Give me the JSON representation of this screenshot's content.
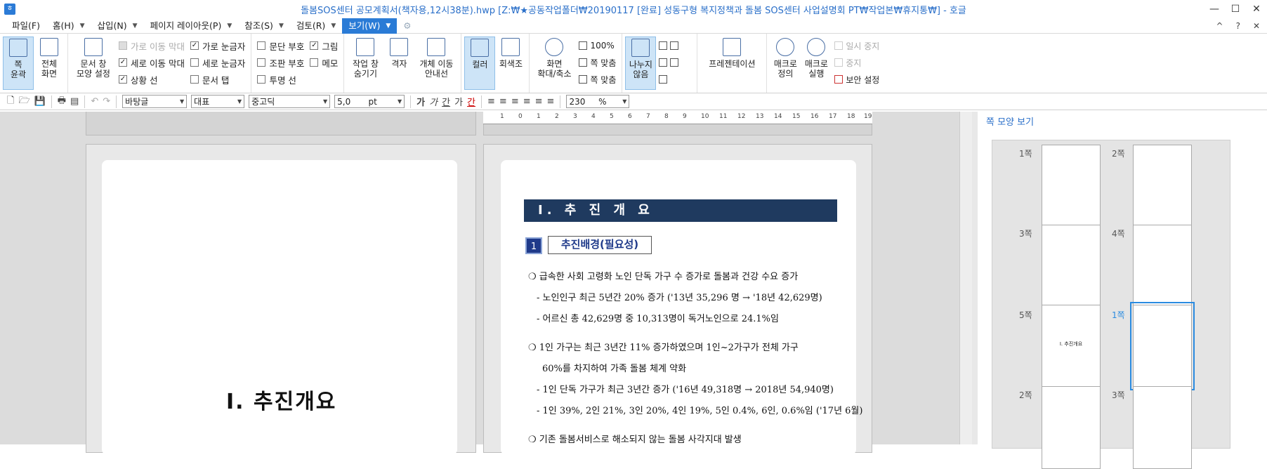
{
  "window": {
    "title": "돌봄SOS센터 공모계획서(책자용,12시38분).hwp [Z:₩★공동작업폴더₩20190117 [완료] 성동구형 복지정책과 돌봄 SOS센터 사업설명회 PT₩작업본₩휴지통₩] - 호글",
    "minimize": "—",
    "maximize": "☐",
    "close": "✕"
  },
  "menu": {
    "items": [
      {
        "label": "파일(F)"
      },
      {
        "label": "홈(H)"
      },
      {
        "label": "삽입(N)"
      },
      {
        "label": "페이지 레이아웃(P)"
      },
      {
        "label": "참조(S)"
      },
      {
        "label": "검토(R)"
      },
      {
        "label": "보기(W)"
      }
    ],
    "right": [
      "^",
      "?",
      "✕"
    ]
  },
  "ribbon": {
    "pagezoom": {
      "l1": "쪽",
      "l2": "윤곽"
    },
    "fullscreen": {
      "l1": "전체",
      "l2": "화면"
    },
    "docwin": {
      "l1": "문서 창",
      "l2": "모양 설정"
    },
    "checks": [
      {
        "label": "가로 이동 막대",
        "checked": false,
        "disabled": true
      },
      {
        "label": "세로 이동 막대",
        "checked": true,
        "disabled": false
      },
      {
        "label": "상황 선",
        "checked": true,
        "disabled": false
      },
      {
        "label": "가로 눈금자",
        "checked": true,
        "disabled": false
      },
      {
        "label": "세로 눈금자",
        "checked": false,
        "disabled": false
      },
      {
        "label": "문서 탭",
        "checked": false,
        "disabled": false
      },
      {
        "label": "문단 부호",
        "checked": false,
        "disabled": false
      },
      {
        "label": "조판 부호",
        "checked": false,
        "disabled": false
      },
      {
        "label": "투명 선",
        "checked": false,
        "disabled": false
      },
      {
        "label": "그림",
        "checked": true,
        "disabled": false
      },
      {
        "label": "메모",
        "checked": false,
        "disabled": false
      }
    ],
    "workwin": {
      "l1": "작업 창",
      "l2": "숨기기"
    },
    "grid": {
      "l1": "격자",
      "l2": ""
    },
    "objmove": {
      "l1": "개체 이동",
      "l2": "안내선"
    },
    "color": {
      "l1": "컬러",
      "l2": ""
    },
    "gray": {
      "l1": "회색조",
      "l2": ""
    },
    "zoom": {
      "l1": "화면",
      "l2": "확대/축소"
    },
    "zoom100": "100%",
    "fitpage": "쪽 맞춤",
    "fitpage2": "쪽 맞춤",
    "nosplit": {
      "l1": "나누지",
      "l2": "않음"
    },
    "present": {
      "l1": "프레젠테이션",
      "l2": ""
    },
    "macrodef": {
      "l1": "매크로",
      "l2": "정의"
    },
    "macrorun": {
      "l1": "매크로",
      "l2": "실행"
    },
    "pause": "일시 중지",
    "stop": "중지",
    "security": "보안 설정"
  },
  "toolbar2": {
    "style": "바탕글",
    "lang": "대표",
    "font": "중고딕",
    "size": "5,0",
    "unit": "pt",
    "zoomval": "230",
    "zoomunit": "%",
    "fmt_bold": "가",
    "fmt_italic": "가",
    "fmt_under": "간",
    "fmt_super": "가",
    "fmt_color": "간"
  },
  "ruler": {
    "ticks": [
      "1",
      "0",
      "1",
      "2",
      "3",
      "4",
      "5",
      "6",
      "7",
      "8",
      "9",
      "10",
      "11",
      "12",
      "13",
      "14",
      "15",
      "16",
      "17",
      "18",
      "19"
    ]
  },
  "sidepanel": {
    "title": "쪽 모양 보기",
    "thumbs": [
      {
        "label": "1쪽"
      },
      {
        "label": "2쪽"
      },
      {
        "label": "3쪽"
      },
      {
        "label": "4쪽"
      },
      {
        "label": "5쪽"
      },
      {
        "label": "1쪽"
      },
      {
        "label": "2쪽"
      },
      {
        "label": "3쪽"
      }
    ],
    "thumb5_text": "Ⅰ. 추진개요"
  },
  "doc": {
    "cover_title": "Ⅰ. 추진개요",
    "h1": "Ⅰ. 추 진 개 요",
    "badge": "1",
    "section": "추진배경(필요성)",
    "lines": [
      "❍ 급속한 사회 고령화 노인 단독 가구 수 증가로 돌봄과 건강 수요 증가",
      "- 노인인구 최근 5년간 20% 증가 ('13년 35,296 명 → '18년 42,629명)",
      "- 어르신 총 42,629명 중 10,313명이 독거노인으로 24.1%임",
      "❍ 1인 가구는 최근 3년간 11% 증가하였으며 1인~2가구가 전체 가구",
      "60%를 차지하여 가족 돌봄 체계 약화",
      "- 1인 단독 가구가 최근 3년간 증가 ('16년 49,318명 → 2018년 54,940명)",
      "- 1인 39%, 2인 21%, 3인 20%, 4인 19%, 5인 0.4%, 6인, 0.6%임 ('17년 6월)",
      "❍ 기존 돌봄서비스로 해소되지 않는 돌봄 사각지대 발생"
    ]
  }
}
